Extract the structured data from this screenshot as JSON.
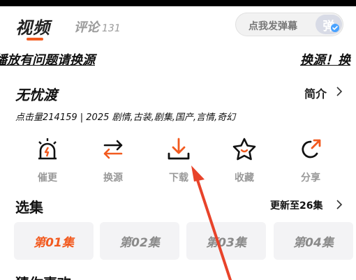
{
  "tabs": {
    "video": "视频",
    "comments": "评论",
    "comments_count": "131"
  },
  "danmaku": {
    "placeholder": "点我发弹幕",
    "button": "弹"
  },
  "notice": {
    "left": "播放有问题请换源",
    "right": "换源！换"
  },
  "show": {
    "title": "无忧渡",
    "intro_label": "简介",
    "meta": "点击量214159 | 2025 剧情,古装,剧集,国产,言情,奇幻"
  },
  "actions": [
    {
      "label": "催更",
      "icon": "alarm-light-icon"
    },
    {
      "label": "换源",
      "icon": "swap-arrows-icon"
    },
    {
      "label": "下载",
      "icon": "download-icon"
    },
    {
      "label": "收藏",
      "icon": "star-icon"
    },
    {
      "label": "分享",
      "icon": "share-icon"
    }
  ],
  "episodes": {
    "section_title": "选集",
    "update_status": "更新至26集",
    "items": [
      "第01集",
      "第02集",
      "第03集",
      "第04集"
    ],
    "active_index": 0
  },
  "next_section": {
    "title": "猜你喜欢"
  },
  "colors": {
    "accent": "#f25a1f",
    "annotation": "#e8432a"
  }
}
